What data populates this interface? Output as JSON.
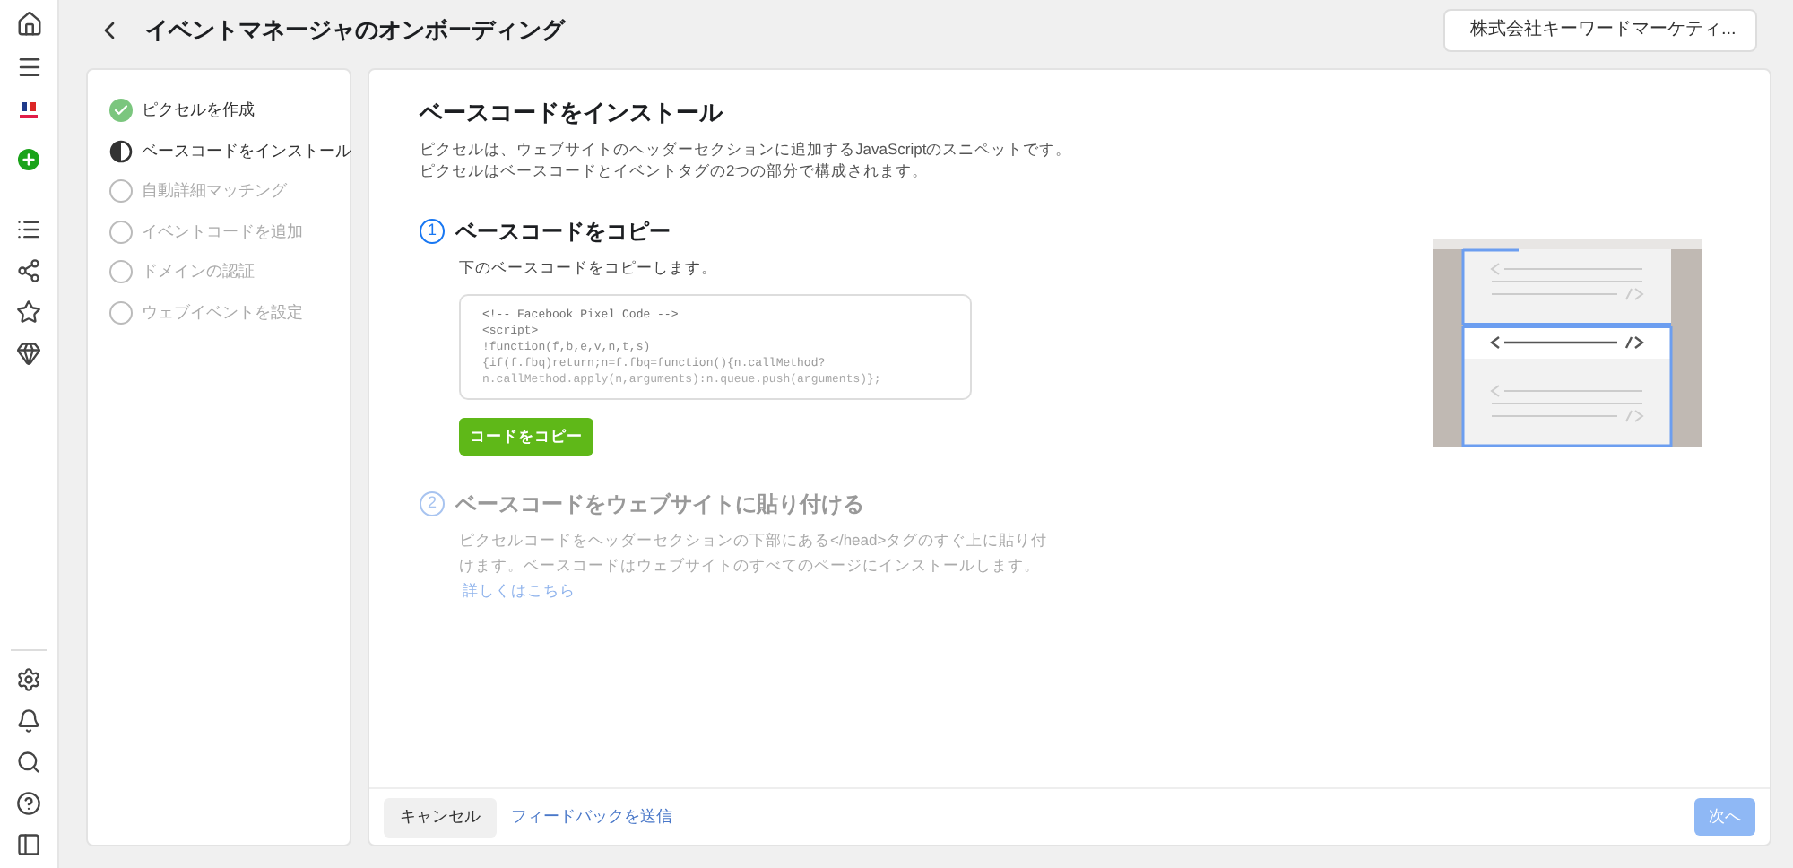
{
  "header": {
    "title": "イベントマネージャのオンボーディング",
    "account": "株式会社キーワードマーケティ..."
  },
  "steps": [
    {
      "label": "ピクセルを作成",
      "kind": "done"
    },
    {
      "label": "ベースコードをインストール",
      "kind": "current"
    },
    {
      "label": "自動詳細マッチング",
      "kind": "pending"
    },
    {
      "label": "イベントコードを追加",
      "kind": "pending"
    },
    {
      "label": "ドメインの認証",
      "kind": "pending"
    },
    {
      "label": "ウェブイベントを設定",
      "kind": "pending"
    }
  ],
  "main": {
    "title": "ベースコードをインストール",
    "intro": [
      "ピクセルは、ウェブサイトのヘッダーセクションに追加するJavaScriptのスニペットです。",
      "ピクセルはベースコードとイベントタグの2つの部分で構成されます。"
    ],
    "sections": [
      {
        "number": "1",
        "title": "ベースコードをコピー",
        "disabled": false,
        "description": "下のベースコードをコピーします。",
        "code": [
          "<!-- Facebook Pixel Code -->",
          "<script>",
          "!function(f,b,e,v,n,t,s)",
          "{if(f.fbq)return;n=f.fbq=function(){n.callMethod?",
          "n.callMethod.apply(n,arguments):n.queue.push(arguments)};"
        ],
        "button": "コードをコピー"
      },
      {
        "number": "2",
        "title": "ベースコードをウェブサイトに貼り付ける",
        "disabled": true,
        "description": "ピクセルコードをヘッダーセクションの下部にある</head>タグのすぐ上に貼り付けます。ベースコードはウェブサイトのすべてのページにインストールします。",
        "link": "詳しくはこちら"
      }
    ]
  },
  "footer": {
    "cancel": "キャンセル",
    "feedback": "フィードバックを送信",
    "next": {
      "label": "次へ",
      "disabled": true
    }
  }
}
